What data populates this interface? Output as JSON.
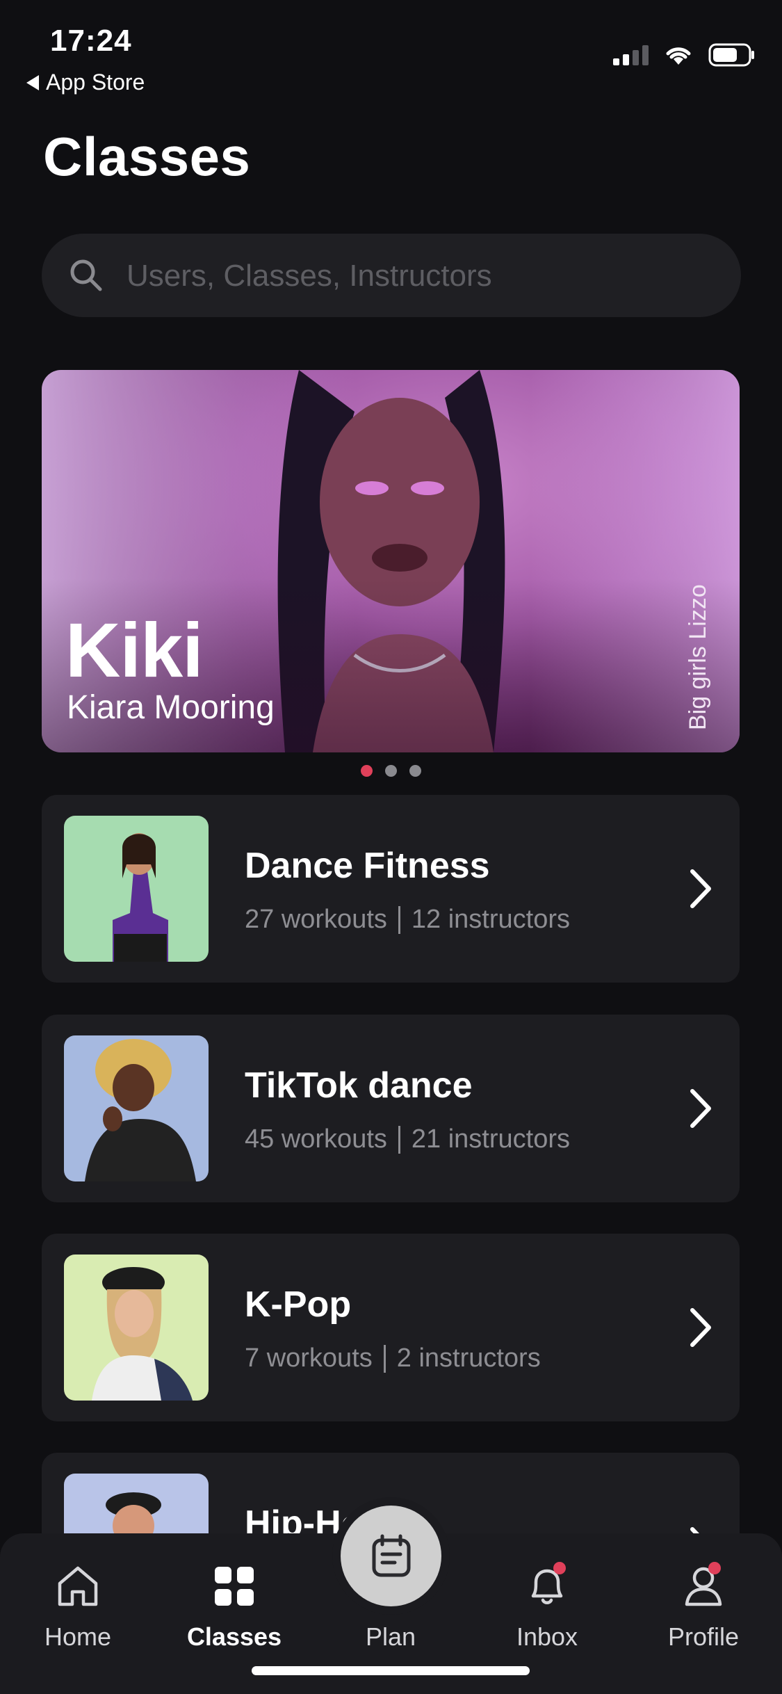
{
  "status": {
    "time": "17:24",
    "back_label": "App Store"
  },
  "page": {
    "title": "Classes"
  },
  "search": {
    "placeholder": "Users, Classes, Instructors"
  },
  "hero": {
    "name": "Kiki",
    "subtitle": "Kiara Mooring",
    "side_label": "Big girls Lizzo"
  },
  "carousel": {
    "count": 3,
    "active_index": 0
  },
  "classes": [
    {
      "title": "Dance Fitness",
      "workouts": "27 workouts",
      "instructors": "12 instructors"
    },
    {
      "title": "TikTok dance",
      "workouts": "45 workouts",
      "instructors": "21 instructors"
    },
    {
      "title": "K-Pop",
      "workouts": "7 workouts",
      "instructors": "2 instructors"
    },
    {
      "title": "Hip-Ho"
    }
  ],
  "tabs": [
    {
      "label": "Home",
      "icon": "home-icon"
    },
    {
      "label": "Classes",
      "icon": "grid-icon",
      "active": true
    },
    {
      "label": "Plan",
      "icon": "calendar-note-icon"
    },
    {
      "label": "Inbox",
      "icon": "bell-icon",
      "badge": true
    },
    {
      "label": "Profile",
      "icon": "user-icon",
      "badge": true
    }
  ],
  "colors": {
    "accent": "#e0405a",
    "card": "#1d1d21",
    "background": "#0f0f12"
  }
}
